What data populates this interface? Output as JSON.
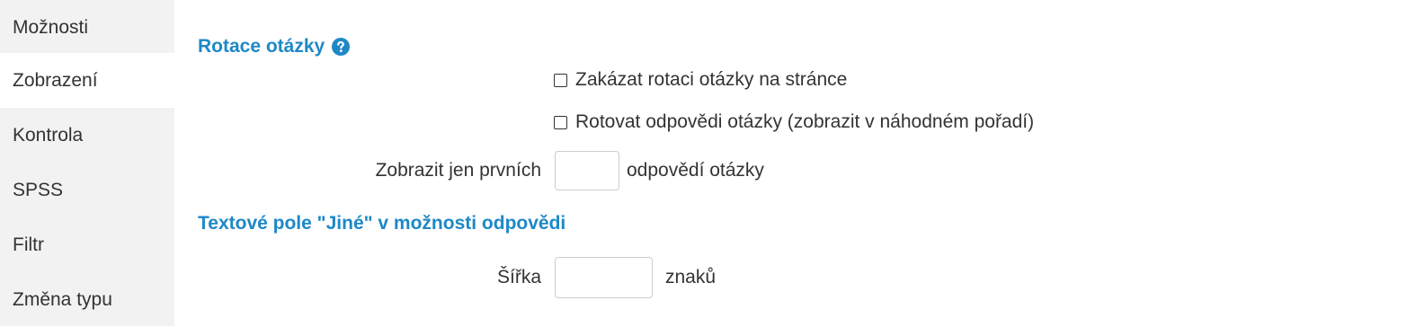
{
  "sidebar": {
    "items": [
      {
        "label": "Možnosti"
      },
      {
        "label": "Zobrazení",
        "active": true
      },
      {
        "label": "Kontrola"
      },
      {
        "label": "SPSS"
      },
      {
        "label": "Filtr"
      },
      {
        "label": "Změna typu"
      }
    ]
  },
  "rotation": {
    "title": "Rotace otázky",
    "help_icon": "question-circle-icon",
    "disable_rotation_label": "Zakázat rotaci otázky na stránce",
    "disable_rotation_checked": false,
    "rotate_answers_label": "Rotovat odpovědi otázky (zobrazit v náhodném pořadí)",
    "rotate_answers_checked": false,
    "show_first_label": "Zobrazit jen prvních",
    "show_first_value": "",
    "show_first_suffix": "odpovědí otázky"
  },
  "other_field": {
    "title": "Textové pole \"Jiné\" v možnosti odpovědi",
    "width_label": "Šířka",
    "width_value": "",
    "width_suffix": "znaků"
  },
  "colors": {
    "accent": "#1e88c7",
    "sidebar_bg": "#f2f2f2",
    "text": "#333333"
  }
}
